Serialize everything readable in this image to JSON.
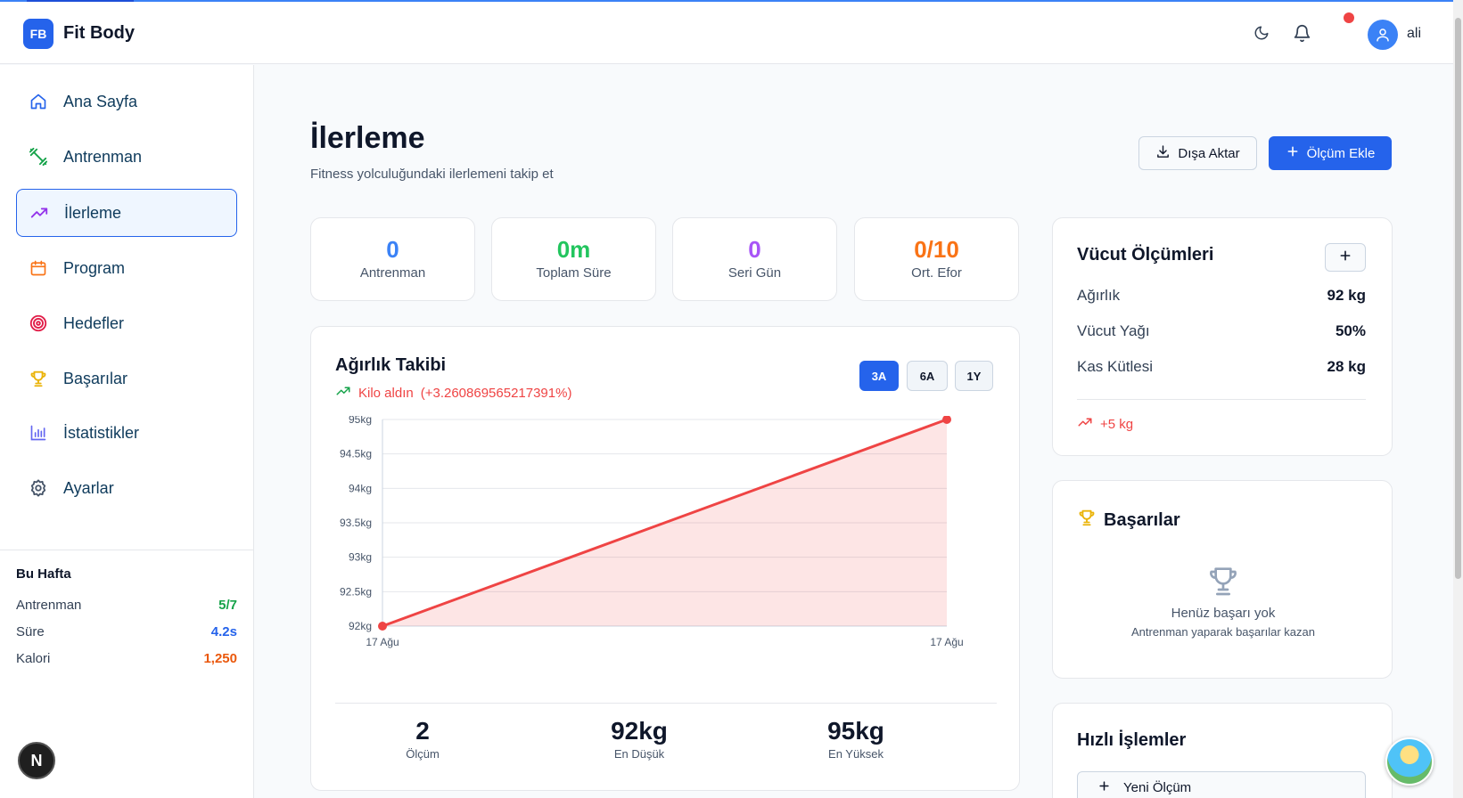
{
  "app": {
    "logo_text": "FB",
    "name": "Fit Body"
  },
  "header": {
    "theme_icon": "moon-icon",
    "notification_icon": "bell-icon",
    "username": "ali"
  },
  "sidebar": {
    "items": [
      {
        "label": "Ana Sayfa",
        "icon": "home-icon"
      },
      {
        "label": "Antrenman",
        "icon": "dumbbell-icon"
      },
      {
        "label": "İlerleme",
        "icon": "trending-up-icon",
        "active": true
      },
      {
        "label": "Program",
        "icon": "calendar-icon"
      },
      {
        "label": "Hedefler",
        "icon": "target-icon"
      },
      {
        "label": "Başarılar",
        "icon": "trophy-icon"
      },
      {
        "label": "İstatistikler",
        "icon": "bar-chart-icon"
      },
      {
        "label": "Ayarlar",
        "icon": "settings-icon"
      }
    ],
    "week": {
      "title": "Bu Hafta",
      "rows": [
        {
          "label": "Antrenman",
          "value": "5/7",
          "color": "#16a34a"
        },
        {
          "label": "Süre",
          "value": "4.2s",
          "color": "#2563eb"
        },
        {
          "label": "Kalori",
          "value": "1,250",
          "color": "#ea580c"
        }
      ]
    },
    "next_badge": "N"
  },
  "page": {
    "title": "İlerleme",
    "subtitle": "Fitness yolculuğundaki ilerlemeni takip et",
    "export_label": "Dışa Aktar",
    "add_label": "Ölçüm Ekle"
  },
  "stats": [
    {
      "value": "0",
      "label": "Antrenman",
      "color": "#3b82f6"
    },
    {
      "value": "0m",
      "label": "Toplam Süre",
      "color": "#22c55e"
    },
    {
      "value": "0",
      "label": "Seri Gün",
      "color": "#a855f7"
    },
    {
      "value": "0/10",
      "label": "Ort. Efor",
      "color": "#f97316"
    }
  ],
  "weight_card": {
    "title": "Ağırlık Takibi",
    "trend_label": "Kilo aldın",
    "trend_value": "(+3.260869565217391%)",
    "ranges": [
      "3A",
      "6A",
      "1Y"
    ],
    "active_range": "3A",
    "summary": [
      {
        "value": "2",
        "label": "Ölçüm"
      },
      {
        "value": "92kg",
        "label": "En Düşük"
      },
      {
        "value": "95kg",
        "label": "En Yüksek"
      }
    ]
  },
  "chart_data": {
    "type": "area",
    "title": "",
    "xlabel": "",
    "ylabel": "",
    "x": [
      "17 Ağu",
      "17 Ağu"
    ],
    "series": [
      {
        "values": [
          92,
          95
        ],
        "color": "#ef4444"
      }
    ],
    "ylim": [
      92,
      95
    ],
    "y_ticks": [
      "95kg",
      "94.5kg",
      "94kg",
      "93.5kg",
      "93kg",
      "92.5kg",
      "92kg"
    ],
    "y_tick_values": [
      95,
      94.5,
      94,
      93.5,
      93,
      92.5,
      92
    ],
    "grid": true
  },
  "body_card": {
    "title": "Vücut Ölçümleri",
    "rows": [
      {
        "label": "Ağırlık",
        "value": "92 kg"
      },
      {
        "label": "Vücut Yağı",
        "value": "50%"
      },
      {
        "label": "Kas Kütlesi",
        "value": "28 kg"
      }
    ],
    "change": "+5 kg"
  },
  "achievements_card": {
    "title": "Başarılar",
    "empty_title": "Henüz başarı yok",
    "empty_sub": "Antrenman yaparak başarılar kazan"
  },
  "quick_card": {
    "title": "Hızlı İşlemler",
    "button": "Yeni Ölçüm"
  }
}
